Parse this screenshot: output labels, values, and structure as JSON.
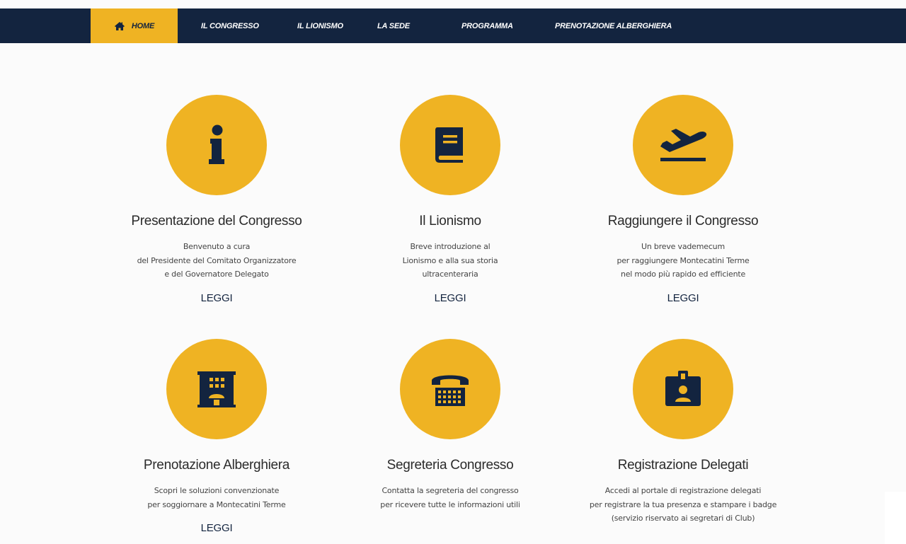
{
  "nav": {
    "items": [
      {
        "label": "HOME",
        "active": true
      },
      {
        "label": "IL CONGRESSO"
      },
      {
        "label": "IL LIONISMO"
      },
      {
        "label": "LA SEDE"
      },
      {
        "label": "PROGRAMMA"
      },
      {
        "label": "PRENOTAZIONE ALBERGHIERA"
      }
    ]
  },
  "colors": {
    "navy": "#13243f",
    "gold": "#efb323",
    "background": "#fbfbfb"
  },
  "cards": [
    {
      "icon": "info-icon",
      "title": "Presentazione del Congresso",
      "desc": [
        "Benvenuto a cura",
        "del Presidente del Comitato Organizzatore",
        "e del Governatore Delegato"
      ],
      "link": "LEGGI"
    },
    {
      "icon": "book-icon",
      "title": "Il Lionismo",
      "desc": [
        "Breve introduzione al",
        "Lionismo e alla sua storia",
        "ultracenteraria"
      ],
      "link": "LEGGI"
    },
    {
      "icon": "plane-departure-icon",
      "title": "Raggiungere il Congresso",
      "desc": [
        "Un breve vademecum",
        "per raggiungere Montecatini Terme",
        "nel modo più rapido ed efficiente"
      ],
      "link": "LEGGI"
    },
    {
      "icon": "hotel-building-icon",
      "title": "Prenotazione Alberghiera",
      "desc": [
        "Scopri le soluzioni convenzionate",
        "per soggiornare a Montecatini Terme"
      ],
      "link": "LEGGI"
    },
    {
      "icon": "telephone-icon",
      "title": "Segreteria Congresso",
      "desc": [
        "Contatta la segreteria del congresso",
        "per ricevere tutte le informazioni utili"
      ]
    },
    {
      "icon": "id-badge-icon",
      "title": "Registrazione Delegati",
      "desc": [
        "Accedi al portale di registrazione delegati",
        "per registrare la tua presenza e stampare i badge",
        "(servizio riservato ai segretari di Club)"
      ]
    }
  ]
}
